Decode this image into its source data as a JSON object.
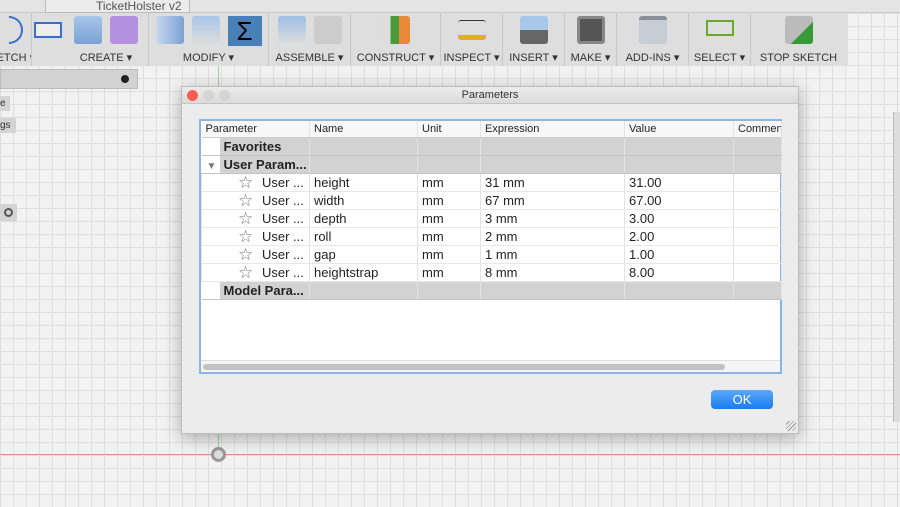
{
  "tab": {
    "title": "TicketHolster v2"
  },
  "toolbar": {
    "groups": [
      {
        "label": "SKETCH",
        "icons": [
          "arc-icon",
          "rectangle-icon"
        ]
      },
      {
        "label": "CREATE",
        "icons": [
          "extrude-icon",
          "form-icon"
        ]
      },
      {
        "label": "MODIFY",
        "icons": [
          "press-pull-icon",
          "fillet-icon",
          "parameters-sigma-icon"
        ]
      },
      {
        "label": "ASSEMBLE",
        "icons": [
          "new-component-icon",
          "joint-icon"
        ]
      },
      {
        "label": "CONSTRUCT",
        "icons": [
          "plane-icon"
        ]
      },
      {
        "label": "INSPECT",
        "icons": [
          "measure-icon"
        ]
      },
      {
        "label": "INSERT",
        "icons": [
          "insert-image-icon"
        ]
      },
      {
        "label": "MAKE",
        "icons": [
          "3d-print-icon"
        ]
      },
      {
        "label": "ADD-INS",
        "icons": [
          "scripts-icon"
        ]
      },
      {
        "label": "SELECT",
        "icons": [
          "select-icon"
        ]
      },
      {
        "label": "STOP SKETCH",
        "icons": [
          "stop-sketch-icon"
        ]
      }
    ]
  },
  "left": {
    "btn1": "e",
    "btn2": "gs"
  },
  "dialog": {
    "title": "Parameters",
    "ok": "OK",
    "columns": [
      "Parameter",
      "Name",
      "Unit",
      "Expression",
      "Value",
      "Comment"
    ],
    "groups": {
      "favorites": "Favorites",
      "user": "User Param...",
      "model": "Model Para..."
    },
    "rows": [
      {
        "param": "User ...",
        "name": "height",
        "unit": "mm",
        "expression": "31 mm",
        "value": "31.00",
        "comment": ""
      },
      {
        "param": "User ...",
        "name": "width",
        "unit": "mm",
        "expression": "67 mm",
        "value": "67.00",
        "comment": ""
      },
      {
        "param": "User ...",
        "name": "depth",
        "unit": "mm",
        "expression": "3 mm",
        "value": "3.00",
        "comment": ""
      },
      {
        "param": "User ...",
        "name": "roll",
        "unit": "mm",
        "expression": "2 mm",
        "value": "2.00",
        "comment": ""
      },
      {
        "param": "User ...",
        "name": "gap",
        "unit": "mm",
        "expression": "1 mm",
        "value": "1.00",
        "comment": ""
      },
      {
        "param": "User ...",
        "name": "heightstrap",
        "unit": "mm",
        "expression": "8 mm",
        "value": "8.00",
        "comment": ""
      }
    ]
  }
}
